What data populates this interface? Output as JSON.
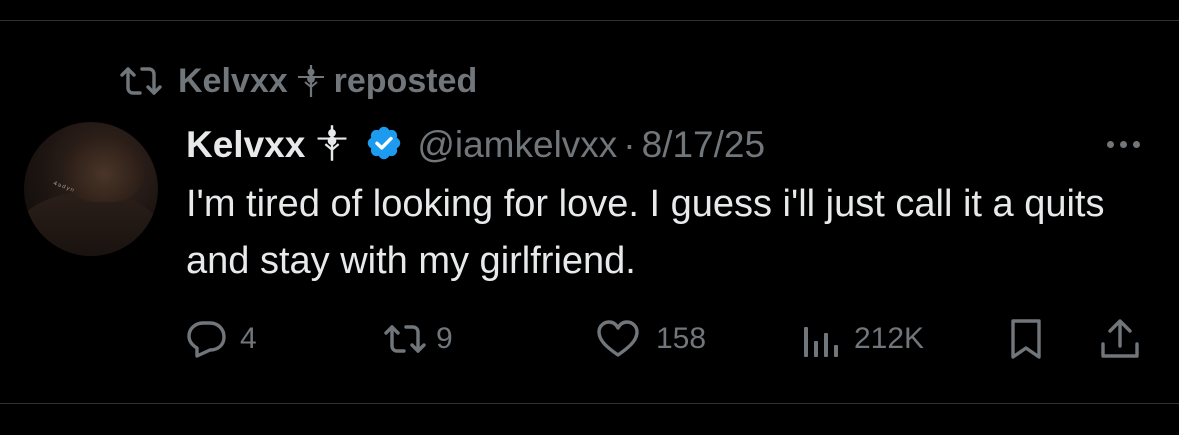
{
  "repost": {
    "user_name": "Kelvxx",
    "label": "reposted"
  },
  "tweet": {
    "author_name": "Kelvxx",
    "handle": "@iamkelvxx",
    "separator": "·",
    "date": "8/17/25",
    "text": "I'm tired of looking for love. I guess i'll just call it a quits and stay with my girlfriend.",
    "avatar_text": "⁴ᵃᵈʸⁿ"
  },
  "actions": {
    "replies": "4",
    "reposts": "9",
    "likes": "158",
    "views": "212K"
  },
  "icons": {
    "repost": "repost-icon",
    "sigil": "sigil-icon",
    "verified": "verified-badge-icon",
    "more": "more-icon",
    "reply": "reply-icon",
    "like": "heart-icon",
    "views": "views-icon",
    "bookmark": "bookmark-icon",
    "share": "share-icon"
  },
  "colors": {
    "background": "#000000",
    "text": "#e7e9ea",
    "muted": "#71767b",
    "verified_blue": "#1d9bf0",
    "divider": "#2f3336"
  }
}
